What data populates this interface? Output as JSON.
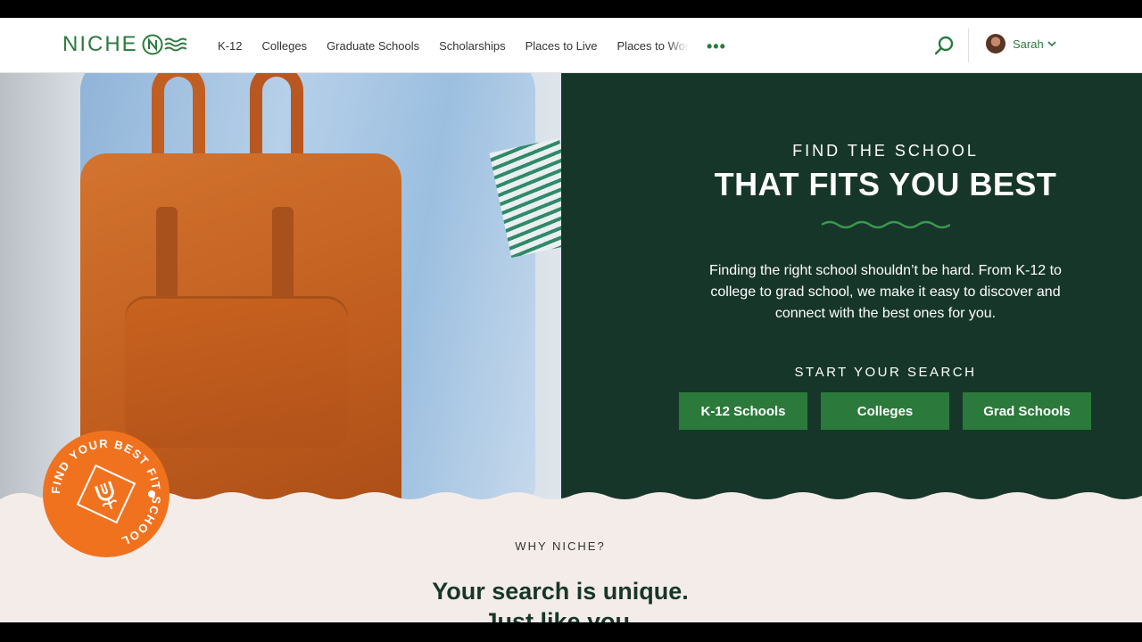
{
  "header": {
    "logo_text": "NICHE",
    "nav": [
      "K-12",
      "Colleges",
      "Graduate Schools",
      "Scholarships",
      "Places to Live",
      "Places to Wor"
    ],
    "more_icon": "ellipsis-icon",
    "search_icon": "search-icon",
    "user": {
      "name": "Sarah"
    }
  },
  "hero": {
    "eyebrow": "FIND THE SCHOOL",
    "title": "THAT FITS YOU BEST",
    "description": "Finding the right school shouldn’t be hard. From K-12 to college to grad school, we make it easy to discover and connect with the best ones for you.",
    "start_label": "START YOUR SEARCH",
    "buttons": [
      "K-12 Schools",
      "Colleges",
      "Grad Schools"
    ],
    "badge_text": "FIND YOUR BEST FIT SCHOOL"
  },
  "why": {
    "eyebrow": "WHY NICHE?",
    "heading_line1": "Your search is unique.",
    "heading_line2": "Just like you."
  },
  "colors": {
    "brand_green": "#2c7a3f",
    "panel_dark": "#17362a",
    "badge_orange": "#f0721f",
    "section_bg": "#f4ece8"
  }
}
